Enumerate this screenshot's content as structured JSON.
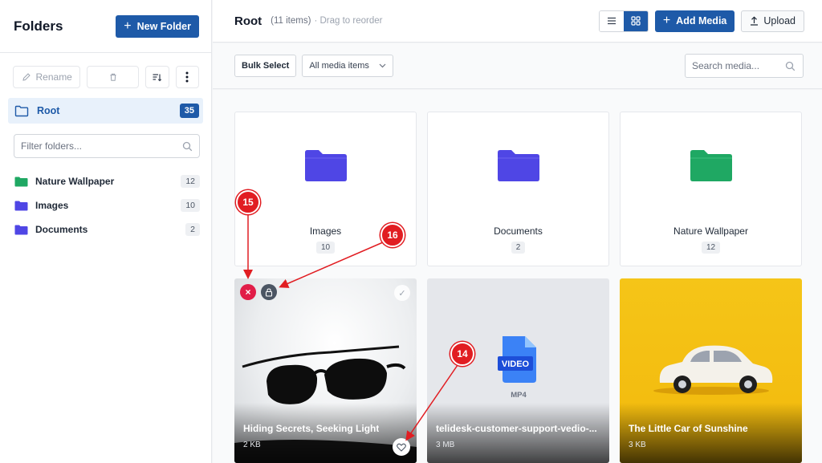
{
  "sidebar": {
    "title": "Folders",
    "new_folder_label": "New Folder",
    "rename_label": "Rename",
    "root": {
      "label": "Root",
      "count": "35"
    },
    "filter_placeholder": "Filter folders...",
    "folders": [
      {
        "name": "Nature Wallpaper",
        "count": "12",
        "color": "#1fa863"
      },
      {
        "name": "Images",
        "count": "10",
        "color": "#4f46e5"
      },
      {
        "name": "Documents",
        "count": "2",
        "color": "#4f46e5"
      }
    ]
  },
  "header": {
    "title": "Root",
    "items": "(11 items)",
    "hint": "· Drag to reorder",
    "add_media_label": "Add Media",
    "upload_label": "Upload"
  },
  "toolbar": {
    "bulk_select_label": "Bulk Select",
    "filter_value": "All media items",
    "search_placeholder": "Search media..."
  },
  "grid": {
    "folders": [
      {
        "name": "Images",
        "count": "10",
        "color": "#4f46e5"
      },
      {
        "name": "Documents",
        "count": "2",
        "color": "#4f46e5"
      },
      {
        "name": "Nature Wallpaper",
        "count": "12",
        "color": "#1fa863"
      }
    ],
    "media": [
      {
        "title": "Hiding Secrets, Seeking Light",
        "size": "2 KB"
      },
      {
        "title": "telidesk-customer-support-vedio-...",
        "size": "3 MB",
        "badge": "VIDEO",
        "ext": "MP4"
      },
      {
        "title": "The Little Car of Sunshine",
        "size": "3 KB"
      }
    ]
  },
  "annotations": {
    "m14": "14",
    "m15": "15",
    "m16": "16"
  }
}
